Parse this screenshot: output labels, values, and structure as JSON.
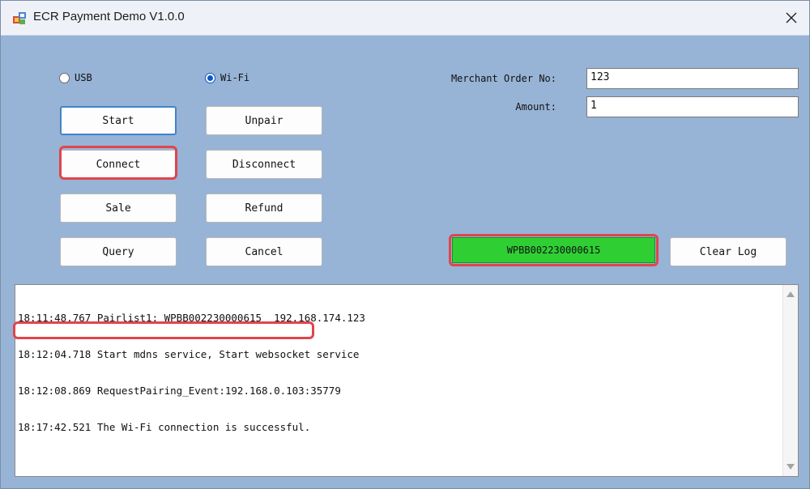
{
  "window": {
    "title": "ECR Payment Demo V1.0.0"
  },
  "connection": {
    "usb_label": "USB",
    "wifi_label": "Wi-Fi",
    "selected": "Wi-Fi"
  },
  "buttons": {
    "start": "Start",
    "unpair": "Unpair",
    "connect": "Connect",
    "disconnect": "Disconnect",
    "sale": "Sale",
    "refund": "Refund",
    "query": "Query",
    "cancel": "Cancel",
    "clear_log": "Clear Log"
  },
  "form": {
    "merchant_order_label": "Merchant Order No:",
    "merchant_order_value": "123",
    "amount_label": "Amount:",
    "amount_value": "1"
  },
  "status": {
    "device_id": "WPBB002230000615",
    "color": "#2fcf34"
  },
  "log": {
    "lines": [
      "18:11:48.767 Pairlist1: WPBB002230000615  192.168.174.123",
      "18:12:04.718 Start mdns service, Start websocket service",
      "18:12:08.869 RequestPairing_Event:192.168.0.103:35779",
      "18:17:42.521 The Wi-Fi connection is successful."
    ]
  },
  "highlight_color": "#e0454d"
}
